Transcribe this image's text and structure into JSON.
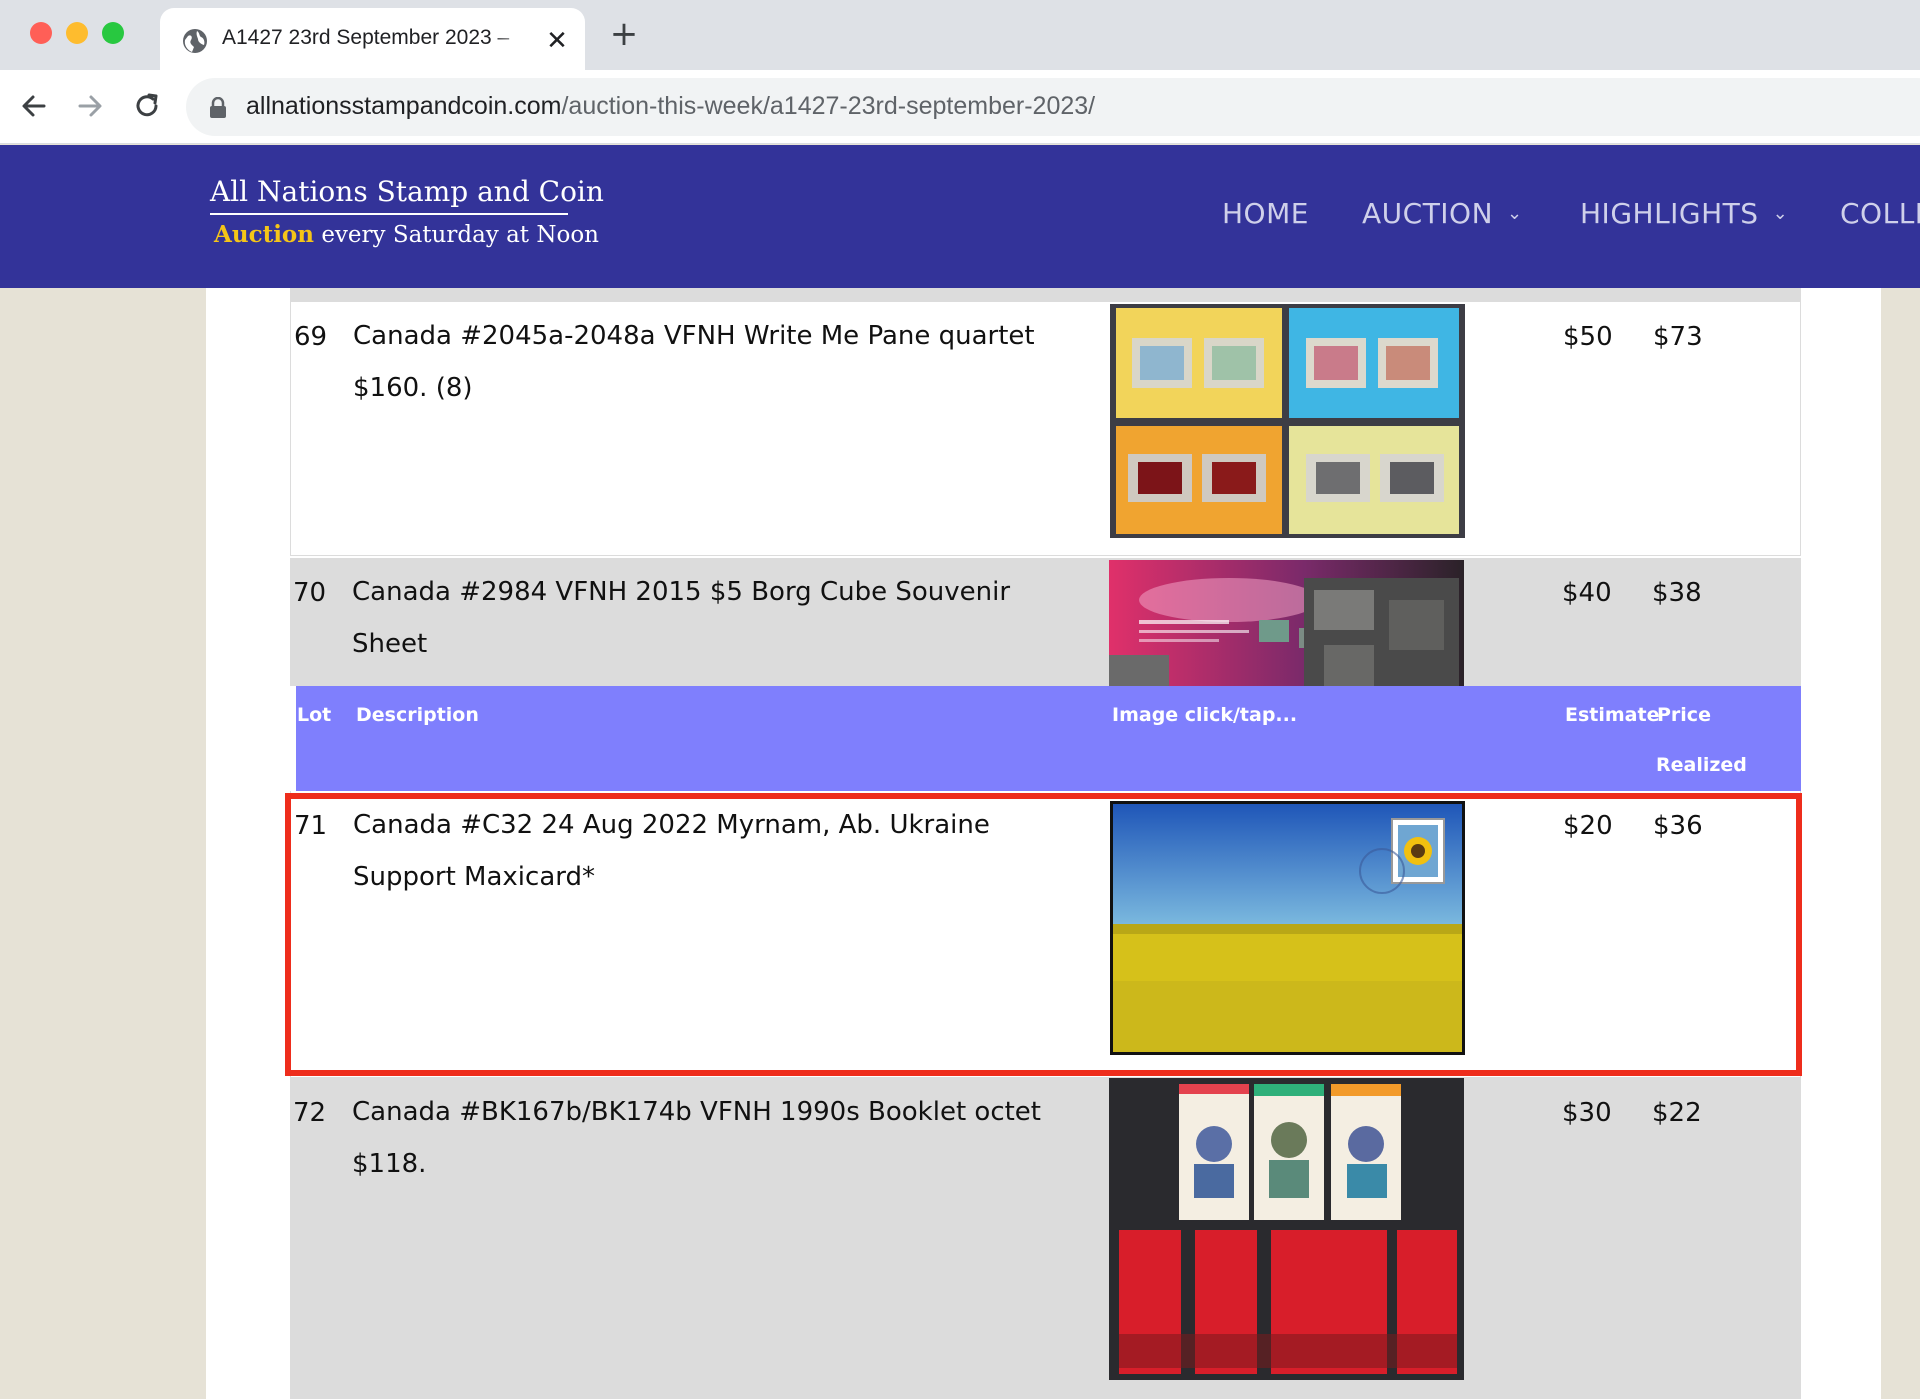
{
  "browser": {
    "tab_title": "A1427 23rd September 2023 –",
    "tab_close": "✕",
    "new_tab": "+",
    "url_domain": "allnationsstampandcoin.com",
    "url_path": "/auction-this-week/a1427-23rd-september-2023/"
  },
  "site": {
    "brand_name": "All Nations Stamp and Coin",
    "tagline_highlight": "Auction",
    "tagline_rest": "every Saturday at Noon",
    "nav": [
      {
        "label": "HOME"
      },
      {
        "label": "AUCTION",
        "chevron": "⌄"
      },
      {
        "label": "HIGHLIGHTS",
        "chevron": "⌄"
      },
      {
        "label": "COLLE"
      }
    ]
  },
  "table": {
    "headers": {
      "lot": "Lot",
      "description": "Description",
      "image": "Image click/tap...",
      "estimate": "Estimate",
      "price": "Price",
      "realized": "Realized"
    },
    "rows": [
      {
        "lot": "69",
        "description": "Canada #2045a-2048a VFNH Write Me Pane quartet $160. (8)",
        "estimate": "$50",
        "price": "$73"
      },
      {
        "lot": "70",
        "description": "Canada #2984 VFNH 2015 $5 Borg Cube Souvenir Sheet",
        "estimate": "$40",
        "price": "$38"
      },
      {
        "lot": "71",
        "description": "Canada #C32 24 Aug 2022 Myrnam, Ab. Ukraine Support Maxicard*",
        "estimate": "$20",
        "price": "$36"
      },
      {
        "lot": "72",
        "description": "Canada #BK167b/BK174b VFNH 1990s Booklet octet $118.",
        "estimate": "$30",
        "price": "$22"
      }
    ]
  },
  "colors": {
    "header_bg": "#333399",
    "table_header_bg": "#7f7ffd",
    "highlight_border": "#ee2d1c",
    "tagline_accent": "#f5c518"
  }
}
